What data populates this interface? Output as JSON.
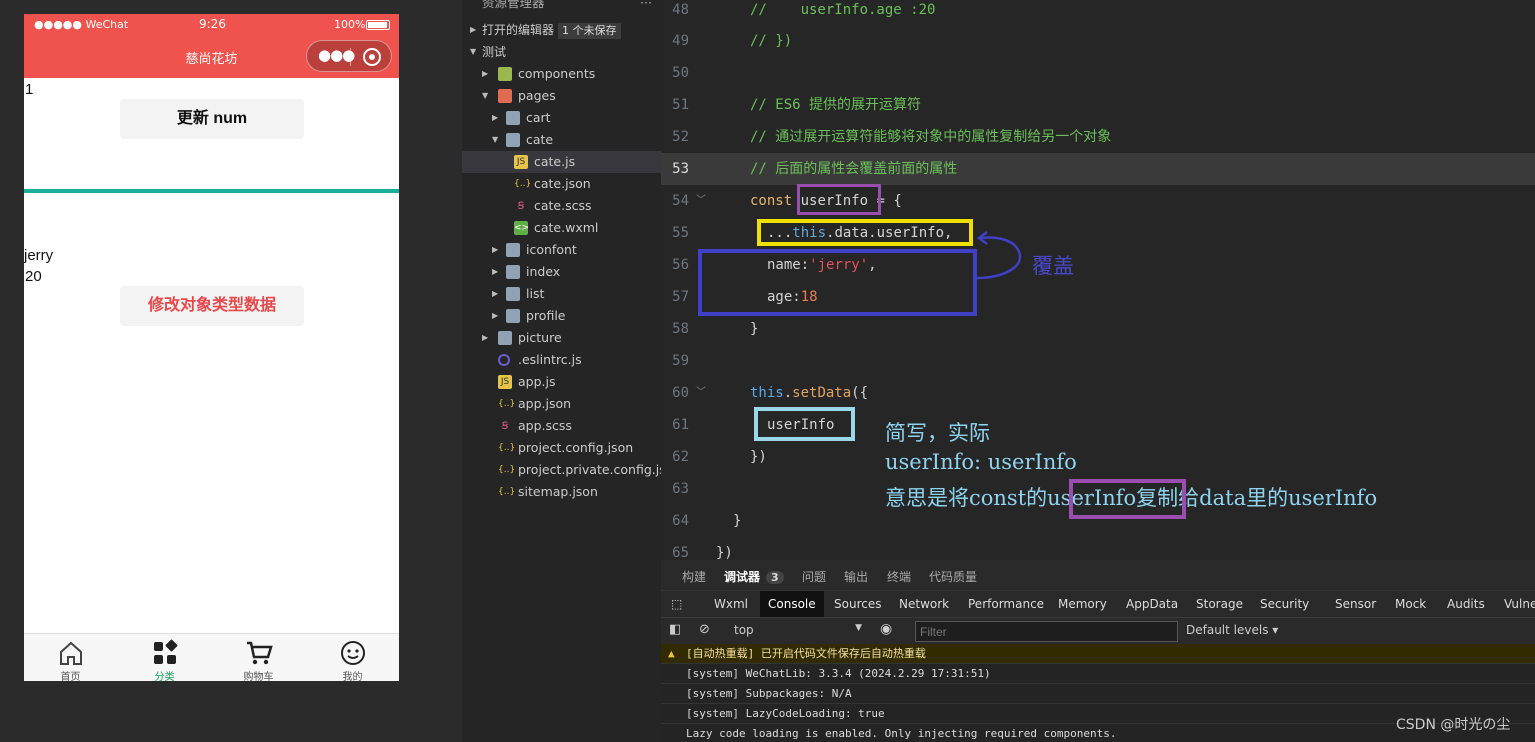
{
  "simulator": {
    "status": {
      "carrier": "●●●●● WeChat",
      "time": "9:26",
      "battery": "100%"
    },
    "nav_title": "慈尚花坊",
    "num_value": "1",
    "update_button": "更新 num",
    "name_value": "jerry",
    "age_value": "20",
    "modify_button": "修改对象类型数据",
    "tabs": [
      {
        "label": "首页",
        "icon": "home-icon"
      },
      {
        "label": "分类",
        "icon": "category-icon",
        "active": true
      },
      {
        "label": "购物车",
        "icon": "cart-icon"
      },
      {
        "label": "我的",
        "icon": "profile-icon"
      }
    ]
  },
  "explorer": {
    "header": "资源管理器",
    "open_editors": "打开的编辑器",
    "unsaved_badge": "1 个未保存",
    "project": "测试",
    "items": [
      {
        "name": "components",
        "type": "folder"
      },
      {
        "name": "pages",
        "type": "folder"
      },
      {
        "name": "cart",
        "type": "folder"
      },
      {
        "name": "cate",
        "type": "folder"
      },
      {
        "name": "cate.js",
        "type": "js"
      },
      {
        "name": "cate.json",
        "type": "json"
      },
      {
        "name": "cate.scss",
        "type": "scss"
      },
      {
        "name": "cate.wxml",
        "type": "wxml"
      },
      {
        "name": "iconfont",
        "type": "folder"
      },
      {
        "name": "index",
        "type": "folder"
      },
      {
        "name": "list",
        "type": "folder"
      },
      {
        "name": "profile",
        "type": "folder"
      },
      {
        "name": "picture",
        "type": "folder"
      },
      {
        "name": ".eslintrc.js",
        "type": "eslint"
      },
      {
        "name": "app.js",
        "type": "js"
      },
      {
        "name": "app.json",
        "type": "json"
      },
      {
        "name": "app.scss",
        "type": "scss"
      },
      {
        "name": "project.config.json",
        "type": "json"
      },
      {
        "name": "project.private.config.js...",
        "type": "json"
      },
      {
        "name": "sitemap.json",
        "type": "json"
      }
    ]
  },
  "editor": {
    "line_numbers": [
      "48",
      "49",
      "50",
      "51",
      "52",
      "53",
      "54",
      "55",
      "56",
      "57",
      "58",
      "59",
      "60",
      "61",
      "62",
      "63",
      "64",
      "65"
    ],
    "l48": "//    userInfo.age :20",
    "l49": "// })",
    "l51": "// ES6 提供的展开运算符",
    "l52": "// 通过展开运算符能够将对象中的属性复制给另一个对象",
    "l53": "// 后面的属性会覆盖前面的属性",
    "l54_kw": "const",
    "l54_var": "userInfo",
    "l54_rest": " = {",
    "l55_spread": "...",
    "l55_this": "this",
    "l55_rest": ".data.userInfo,",
    "l56_key": "name:",
    "l56_val": "'jerry'",
    "l56_end": ",",
    "l57_key": "age:",
    "l57_val": "18",
    "l58": "}",
    "l60_this": "this",
    "l60_dot": ".",
    "l60_fn": "setData",
    "l60_rest": "({",
    "l61": "userInfo",
    "l62": "})",
    "l64": "}",
    "l65": "})",
    "annotation_cover": "覆盖",
    "annotation_1": "简写，实际",
    "annotation_2": "userInfo: userInfo",
    "annotation_3a": "意思是将const的",
    "annotation_3b": "userInfo",
    "annotation_3c": "复制给data里的userInfo"
  },
  "devtools": {
    "top_tabs": [
      "构建",
      "调试器",
      "问题",
      "输出",
      "终端",
      "代码质量"
    ],
    "debugger_count": "3",
    "tabs": [
      "Wxml",
      "Console",
      "Sources",
      "Network",
      "Performance",
      "Memory",
      "AppData",
      "Storage",
      "Security",
      "Sensor",
      "Mock",
      "Audits",
      "Vulne"
    ],
    "context": "top",
    "filter_placeholder": "Filter",
    "levels": "Default levels ▾",
    "messages": [
      "[自动热重载] 已开启代码文件保存后自动热重载",
      "[system] WeChatLib: 3.3.4 (2024.2.29 17:31:51)",
      "[system] Subpackages: N/A",
      "[system] LazyCodeLoading: true",
      "Lazy code loading is enabled. Only injecting required components."
    ]
  },
  "watermark": "CSDN @时光の尘",
  "colors": {
    "nav_red": "#f0534e",
    "divider_teal": "#1aad9b",
    "box_purple": "#9a4fb0",
    "box_yellow": "#f0e000",
    "box_blue": "#3f3fc8",
    "box_cyan": "#9ad8e8"
  }
}
